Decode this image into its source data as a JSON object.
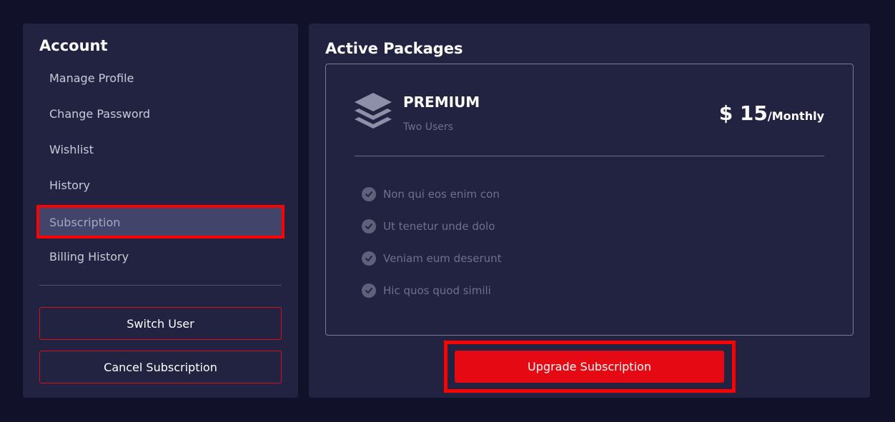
{
  "sidebar": {
    "title": "Account",
    "items": [
      {
        "label": "Manage Profile"
      },
      {
        "label": "Change Password"
      },
      {
        "label": "Wishlist"
      },
      {
        "label": "History"
      },
      {
        "label": "Subscription",
        "active": true
      },
      {
        "label": "Billing History"
      }
    ],
    "switch_user_label": "Switch User",
    "cancel_subscription_label": "Cancel Subscription"
  },
  "main": {
    "title": "Active Packages",
    "package": {
      "icon": "layers-icon",
      "name": "PREMIUM",
      "subtitle": "Two Users",
      "price_amount": "$ 15",
      "price_period": "/Monthly",
      "features": [
        "Non qui eos enim con",
        "Ut tenetur unde dolo",
        "Veniam eum deserunt",
        "Hic quos quod simili"
      ]
    },
    "upgrade_label": "Upgrade Subscription"
  },
  "colors": {
    "background": "#11112a",
    "panel": "#222340",
    "accent_red": "#e50914",
    "active_item": "#43446a",
    "highlight_outline": "#ff0000"
  }
}
